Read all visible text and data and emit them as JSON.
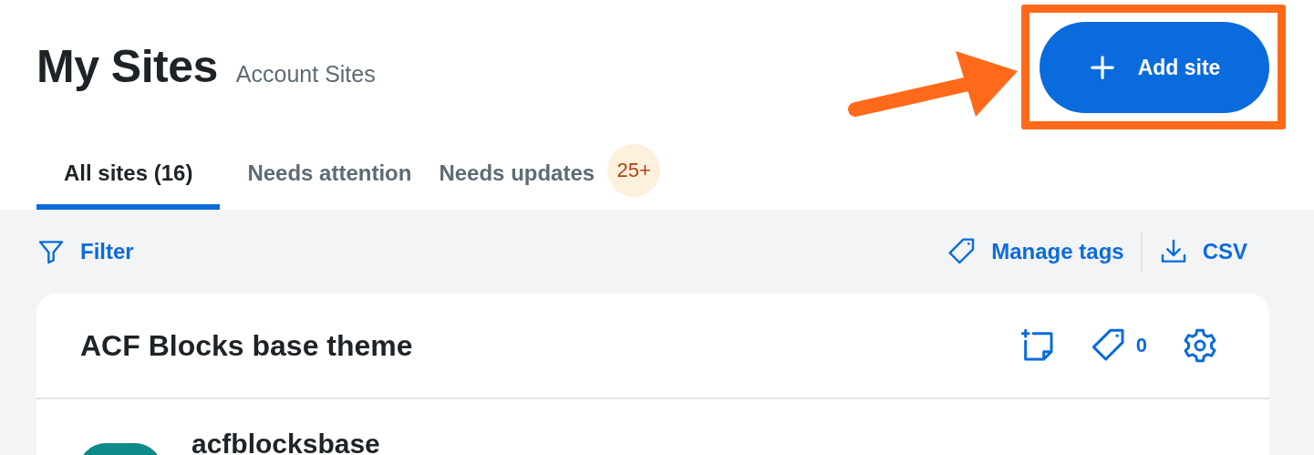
{
  "header": {
    "title": "My Sites",
    "subtitle": "Account Sites",
    "add_button": "Add site"
  },
  "tabs": [
    {
      "label": "All sites (16)",
      "selected": true
    },
    {
      "label": "Needs attention",
      "selected": false
    },
    {
      "label": "Needs updates",
      "selected": false,
      "badge": "25+"
    }
  ],
  "toolbar": {
    "filter": "Filter",
    "manage_tags": "Manage tags",
    "csv": "CSV"
  },
  "card": {
    "title": "ACF Blocks base theme",
    "tag_count": "0",
    "sites": [
      {
        "name": "acfblocksbase"
      }
    ]
  }
}
